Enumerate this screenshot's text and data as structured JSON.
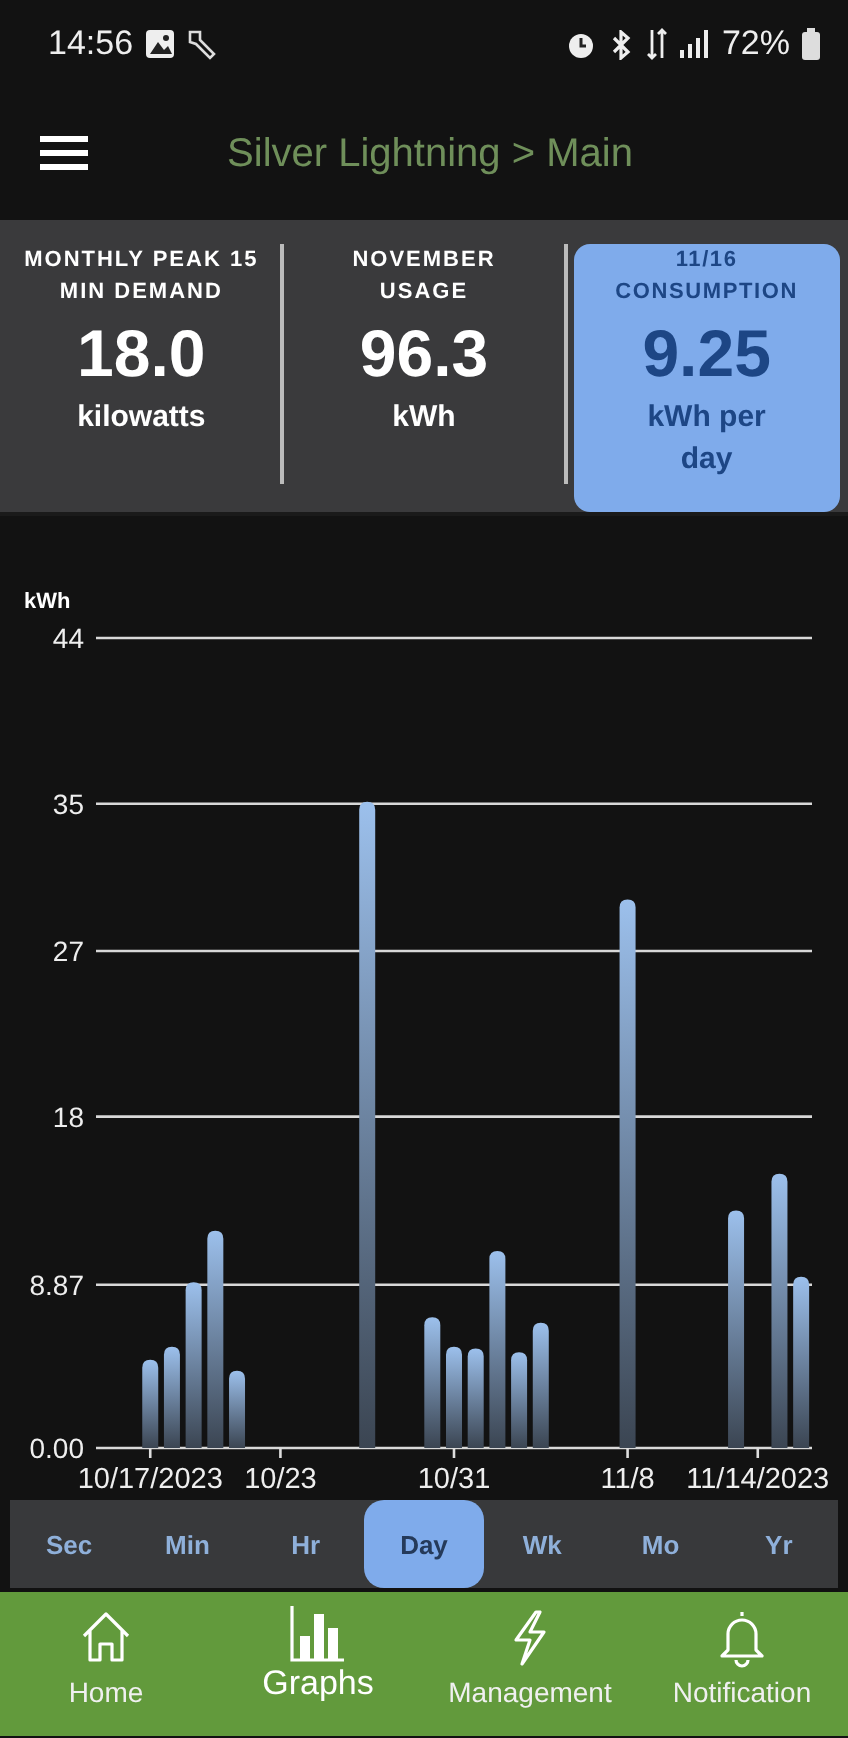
{
  "status_bar": {
    "time": "14:56",
    "battery": "72%"
  },
  "app_bar": {
    "title": "Silver Lightning > Main"
  },
  "stats": [
    {
      "label": "MONTHLY PEAK 15 MIN DEMAND",
      "value": "18.0",
      "unit": "kilowatts",
      "selected": false
    },
    {
      "label": "NOVEMBER USAGE",
      "value": "96.3",
      "unit": "kWh",
      "selected": false
    },
    {
      "label": "11/16 CONSUMPTION",
      "value": "9.25",
      "unit": "kWh per day",
      "selected": true
    }
  ],
  "chart": {
    "chart_data": {
      "type": "bar",
      "ylabel": "kWh",
      "categories": [
        "10/17/2023",
        null,
        null,
        null,
        null,
        null,
        "10/23",
        null,
        null,
        null,
        null,
        null,
        null,
        null,
        "10/31",
        null,
        null,
        null,
        null,
        null,
        null,
        null,
        "11/8",
        null,
        null,
        null,
        null,
        null,
        "11/14/2023",
        null,
        null
      ],
      "values": [
        4.8,
        5.5,
        9.0,
        11.8,
        4.2,
        null,
        null,
        null,
        null,
        null,
        35.1,
        null,
        null,
        7.1,
        5.5,
        5.4,
        10.7,
        5.2,
        6.8,
        null,
        null,
        null,
        29.8,
        null,
        null,
        null,
        null,
        12.9,
        null,
        14.9,
        9.3
      ],
      "ylim": [
        0,
        44
      ],
      "grid": true,
      "yticks": [
        {
          "value": 0,
          "label": "0.00"
        },
        {
          "value": 8.87,
          "label": "8.87"
        },
        {
          "value": 18,
          "label": "18"
        },
        {
          "value": 27,
          "label": "27"
        },
        {
          "value": 35,
          "label": "35"
        },
        {
          "value": 44,
          "label": "44"
        }
      ]
    }
  },
  "ranges": [
    {
      "label": "Sec",
      "selected": false
    },
    {
      "label": "Min",
      "selected": false
    },
    {
      "label": "Hr",
      "selected": false
    },
    {
      "label": "Day",
      "selected": true
    },
    {
      "label": "Wk",
      "selected": false
    },
    {
      "label": "Mo",
      "selected": false
    },
    {
      "label": "Yr",
      "selected": false
    }
  ],
  "nav": [
    {
      "label": "Home",
      "kind": "home",
      "selected": false
    },
    {
      "label": "Graphs",
      "kind": "graphs",
      "selected": true
    },
    {
      "label": "Management",
      "kind": "management",
      "selected": false
    },
    {
      "label": "Notification",
      "kind": "notification",
      "selected": false
    }
  ]
}
